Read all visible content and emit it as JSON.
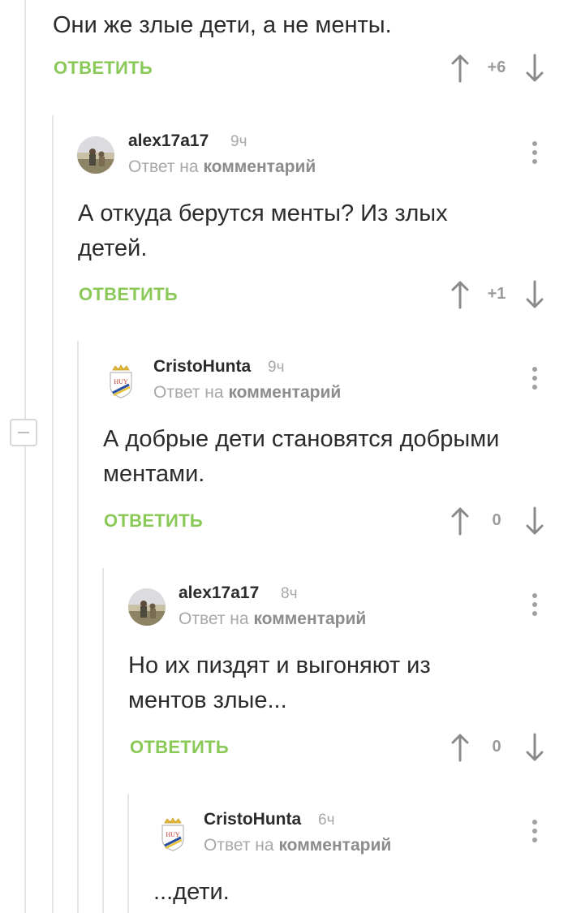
{
  "top": {
    "text": "Они же злые дети, а не менты.",
    "reply": "ОТВЕТИТЬ",
    "rating": "+6"
  },
  "comments": [
    {
      "user": "alex17a17",
      "time": "9ч",
      "reply_to_prefix": "Ответ на",
      "reply_to_target": "комментарий",
      "text": "А откуда берутся менты? Из злых\nдетей.",
      "reply": "ОТВЕТИТЬ",
      "rating": "+1",
      "avatar": "photo-avatar"
    },
    {
      "user": "CristoHunta",
      "time": "9ч",
      "reply_to_prefix": "Ответ на",
      "reply_to_target": "комментарий",
      "text": "А добрые дети становятся добрыми\nментами.",
      "reply": "ОТВЕТИТЬ",
      "rating": "0",
      "avatar": "crest-avatar"
    },
    {
      "user": "alex17a17",
      "time": "8ч",
      "reply_to_prefix": "Ответ на",
      "reply_to_target": "комментарий",
      "text": "Но их пиздят и выгоняют из\nментов злые...",
      "reply": "ОТВЕТИТЬ",
      "rating": "0",
      "avatar": "photo-avatar"
    },
    {
      "user": "CristoHunta",
      "time": "6ч",
      "reply_to_prefix": "Ответ на",
      "reply_to_target": "комментарий",
      "text": "...дети.",
      "avatar": "crest-avatar"
    }
  ],
  "crest_text": "HUY",
  "colors": {
    "reply_green": "#8ac858",
    "thread_line": "#e6e6e6",
    "text": "#2b2b2b",
    "muted": "#a8a8a8"
  }
}
